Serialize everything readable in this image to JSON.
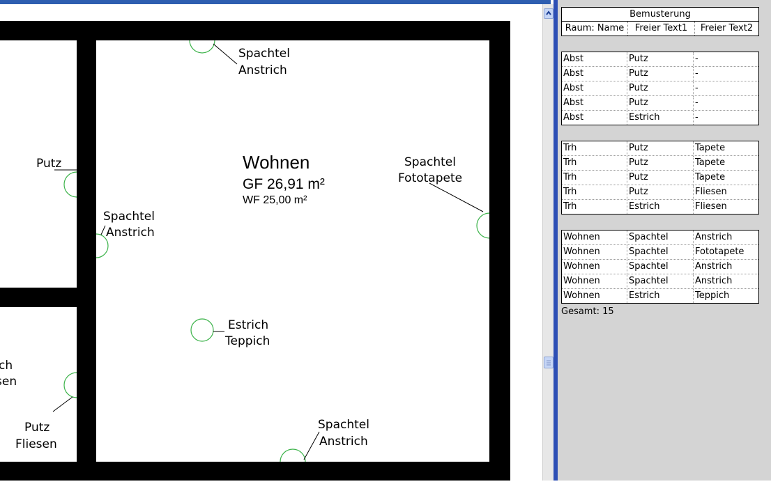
{
  "plan": {
    "room_name": "Wohnen",
    "room_gf": "GF 26,91 m²",
    "room_wf": "WF 25,00 m²",
    "tag_top_l1": "Spachtel",
    "tag_top_l2": "Anstrich",
    "tag_right_l1": "Spachtel",
    "tag_right_l2": "Fototapete",
    "tag_left_l1": "Spachtel",
    "tag_left_l2": "Anstrich",
    "tag_center_l1": "Estrich",
    "tag_center_l2": "Teppich",
    "tag_bottom_l1": "Spachtel",
    "tag_bottom_l2": "Anstrich",
    "tag_putz_upper": "Putz",
    "tag_lowerleft_l1": "Putz",
    "tag_lowerleft_l2": "Fliesen",
    "tag_cut_l1": "ch",
    "tag_cut_l2": "sen"
  },
  "schedule": {
    "title": "Bemusterung",
    "columns": [
      "Raum: Name",
      "Freier Text1",
      "Freier Text2"
    ],
    "groups": [
      [
        [
          "Abst",
          "Putz",
          "-"
        ],
        [
          "Abst",
          "Putz",
          "-"
        ],
        [
          "Abst",
          "Putz",
          "-"
        ],
        [
          "Abst",
          "Putz",
          "-"
        ],
        [
          "Abst",
          "Estrich",
          "-"
        ]
      ],
      [
        [
          "Trh",
          "Putz",
          "Tapete"
        ],
        [
          "Trh",
          "Putz",
          "Tapete"
        ],
        [
          "Trh",
          "Putz",
          "Tapete"
        ],
        [
          "Trh",
          "Putz",
          "Fliesen"
        ],
        [
          "Trh",
          "Estrich",
          "Fliesen"
        ]
      ],
      [
        [
          "Wohnen",
          "Spachtel",
          "Anstrich"
        ],
        [
          "Wohnen",
          "Spachtel",
          "Fototapete"
        ],
        [
          "Wohnen",
          "Spachtel",
          "Anstrich"
        ],
        [
          "Wohnen",
          "Spachtel",
          "Anstrich"
        ],
        [
          "Wohnen",
          "Estrich",
          "Teppich"
        ]
      ]
    ],
    "total": "Gesamt: 15"
  },
  "colors": {
    "tag_circle": "#3cb34a",
    "wall": "#000000",
    "accent_blue": "#2d4fb5"
  },
  "icons": {
    "scroll_up": "chevron-up-icon",
    "scroll_thumb": "grip-icon"
  }
}
